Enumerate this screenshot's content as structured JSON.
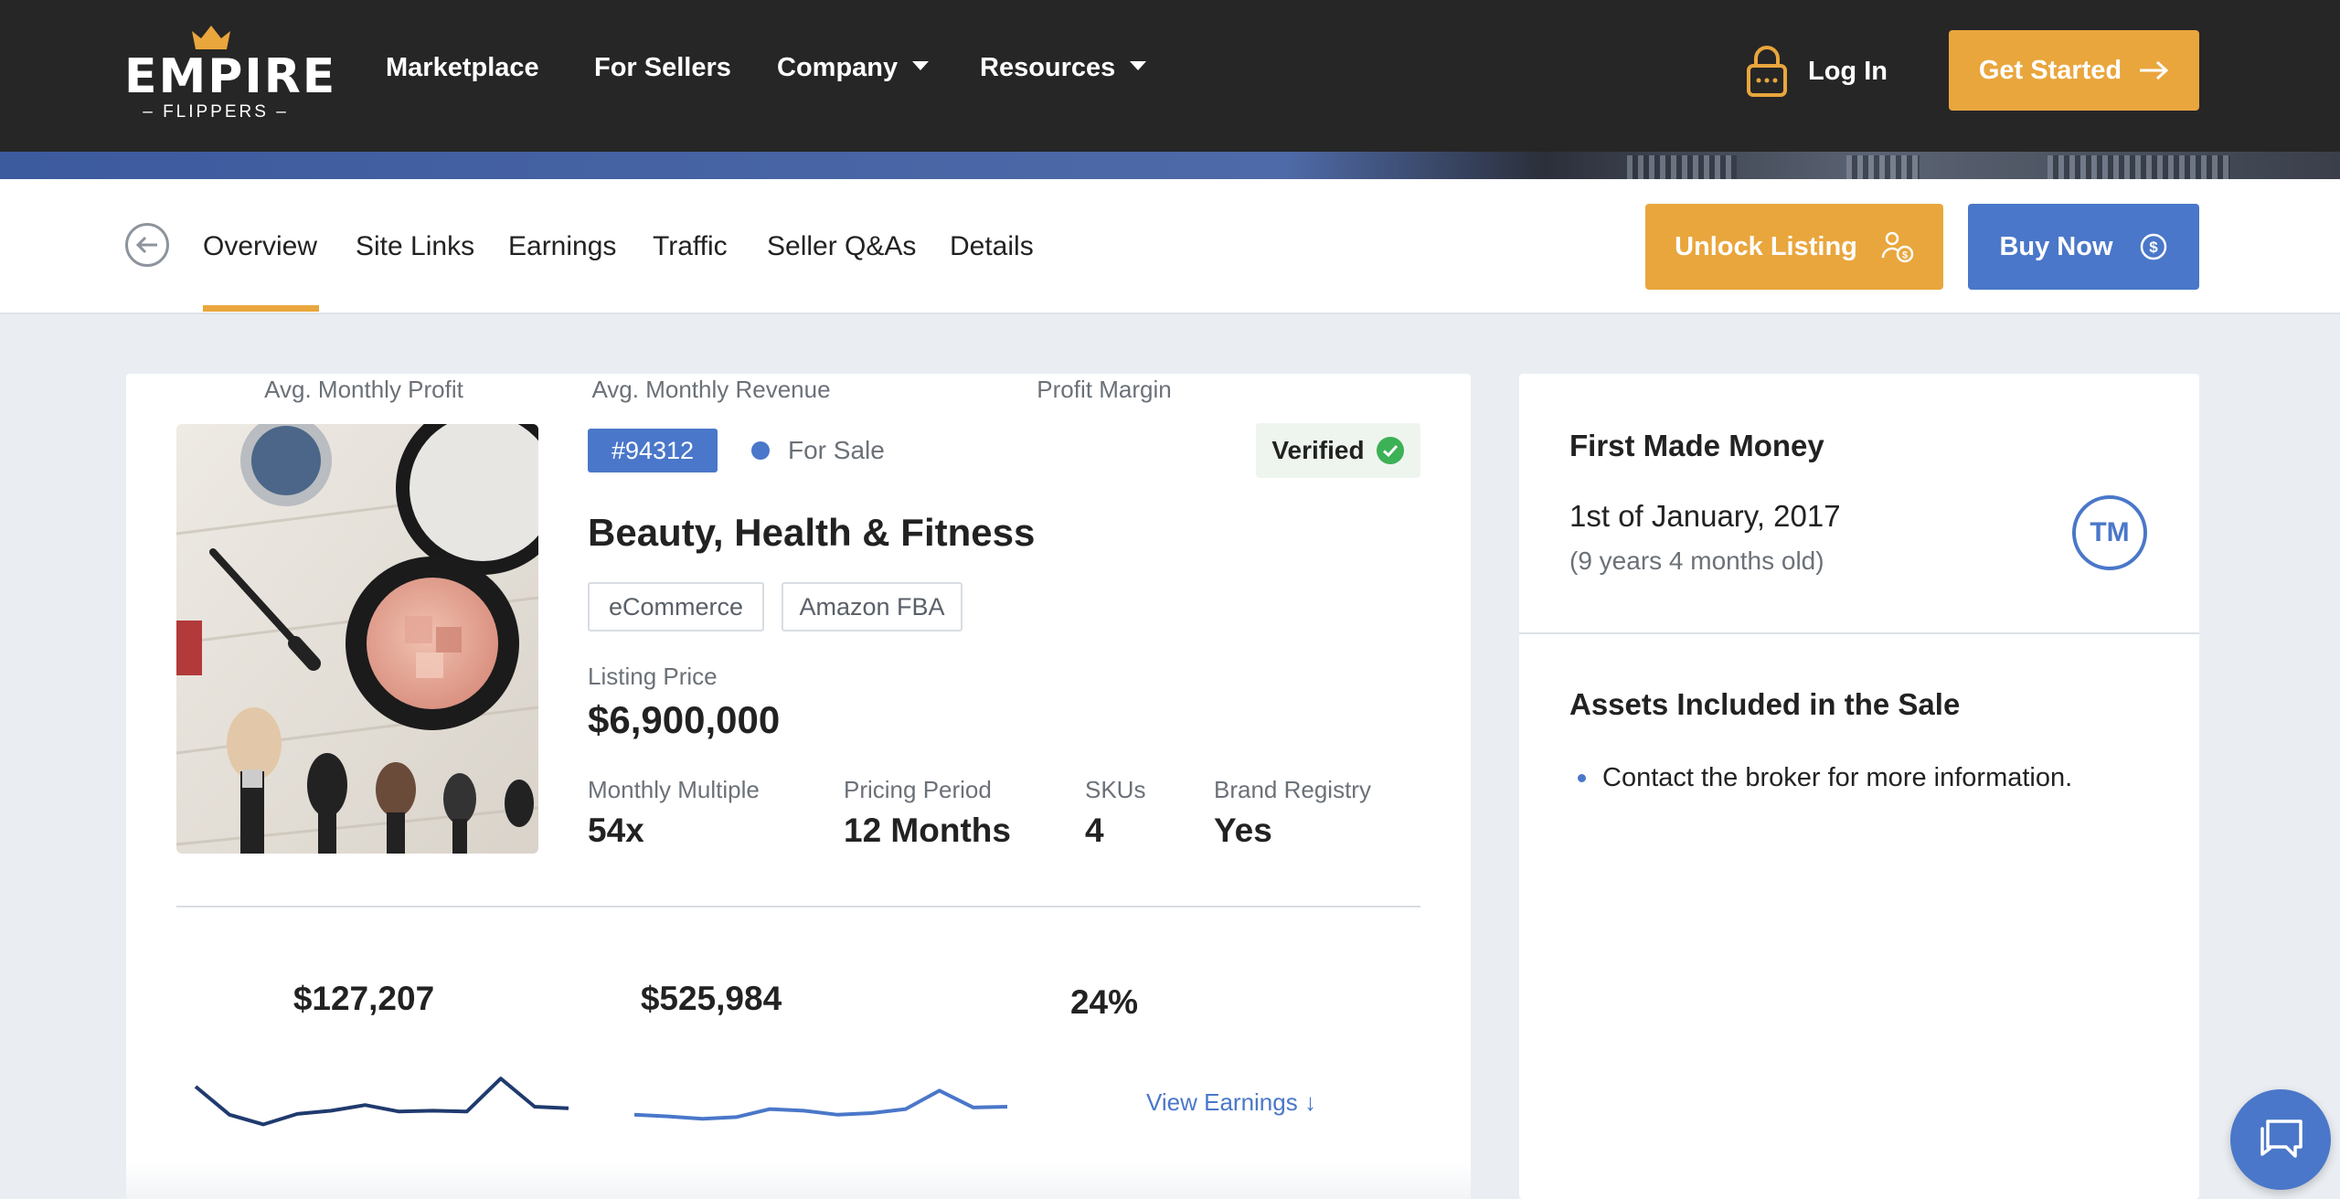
{
  "brand": {
    "name": "EMPIRE",
    "tagline": "FLIPPERS"
  },
  "topnav": {
    "links": [
      {
        "label": "Marketplace"
      },
      {
        "label": "For Sellers"
      },
      {
        "label": "Company"
      },
      {
        "label": "Resources"
      }
    ],
    "login_label": "Log In",
    "cta_label": "Get Started"
  },
  "tabs": [
    {
      "label": "Overview",
      "active": true
    },
    {
      "label": "Site Links"
    },
    {
      "label": "Earnings"
    },
    {
      "label": "Traffic"
    },
    {
      "label": "Seller Q&As"
    },
    {
      "label": "Details"
    }
  ],
  "actions": {
    "unlock_label": "Unlock Listing",
    "buy_label": "Buy Now"
  },
  "listing": {
    "id": "#94312",
    "status": "For Sale",
    "verified_label": "Verified",
    "title": "Beauty, Health & Fitness",
    "tags": [
      "eCommerce",
      "Amazon FBA"
    ],
    "price_label": "Listing Price",
    "price": "$6,900,000",
    "metrics": [
      {
        "label": "Monthly Multiple",
        "value": "54x"
      },
      {
        "label": "Pricing Period",
        "value": "12 Months"
      },
      {
        "label": "SKUs",
        "value": "4"
      },
      {
        "label": "Brand Registry",
        "value": "Yes"
      }
    ]
  },
  "stats": {
    "profit": {
      "label": "Avg. Monthly Profit",
      "value": "$127,207"
    },
    "revenue": {
      "label": "Avg. Monthly Revenue",
      "value": "$525,984"
    },
    "margin": {
      "label": "Profit Margin",
      "value": "24%"
    },
    "view_earnings_label": "View Earnings ↓"
  },
  "chart_data": [
    {
      "type": "line",
      "series": [
        {
          "color": "#1f3a6e",
          "values": [
            75,
            40,
            28,
            41,
            45,
            52,
            44,
            45,
            44,
            85,
            50,
            48
          ]
        }
      ]
    },
    {
      "type": "line",
      "series": [
        {
          "color": "#4a77c9",
          "values": [
            40,
            38,
            35,
            37,
            47,
            45,
            40,
            42,
            47,
            70,
            49,
            50
          ]
        }
      ]
    }
  ],
  "side": {
    "first_money_title": "First Made Money",
    "first_money_date": "1st of January, 2017",
    "first_money_age": "(9 years 4 months old)",
    "tm_label": "TM",
    "assets_title": "Assets Included in the Sale",
    "assets": [
      "Contact the broker for more information."
    ]
  },
  "colors": {
    "accent_orange": "#e9a63d",
    "accent_blue": "#4a77c9",
    "nav_bg": "#262626",
    "page_bg": "#eaeef2"
  }
}
